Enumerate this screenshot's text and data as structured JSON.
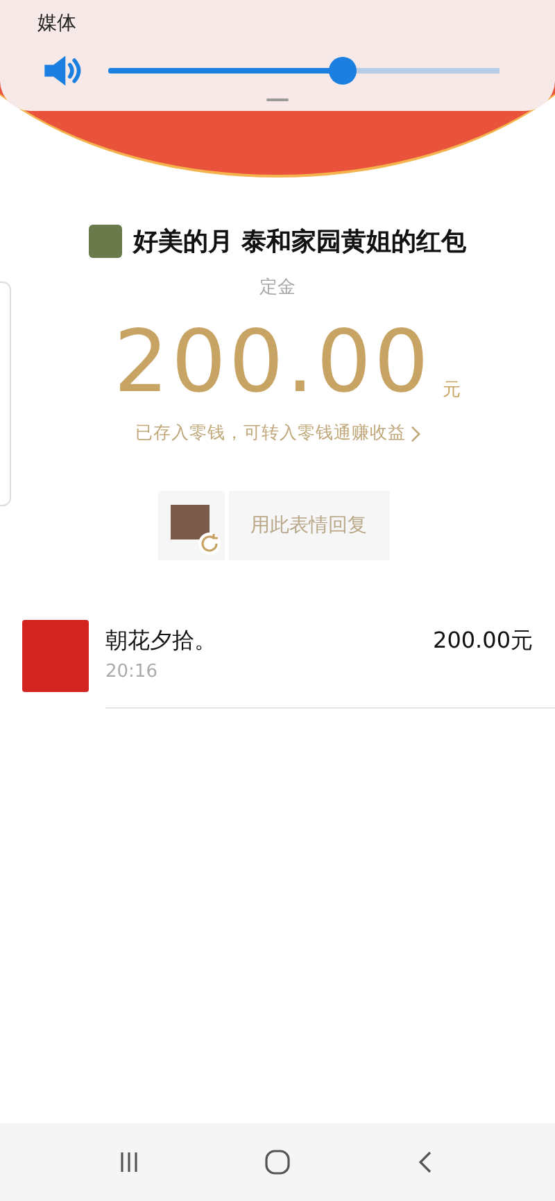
{
  "volume_panel": {
    "label": "媒体",
    "level": 0.6
  },
  "red_packet": {
    "title": "好美的月 泰和家园黄姐的红包",
    "note": "定金",
    "amount": "200.00",
    "unit": "元",
    "hint": "已存入零钱，可转入零钱通赚收益",
    "reply_button": "用此表情回复"
  },
  "records": [
    {
      "name": "朝花夕拾。",
      "time": "20:16",
      "amount": "200.00元"
    }
  ]
}
